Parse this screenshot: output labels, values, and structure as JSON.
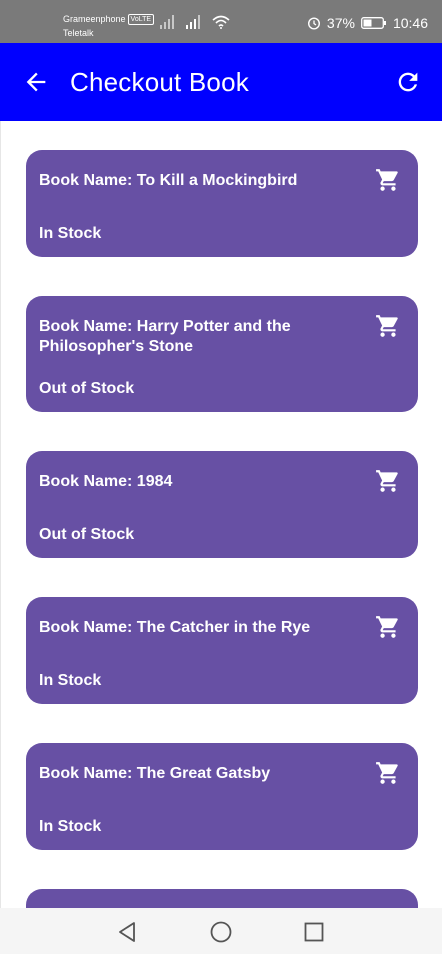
{
  "status_bar": {
    "carrier_1": "Grameenphone",
    "volte": "VoLTE",
    "carrier_2": "Teletalk",
    "battery": "37%",
    "time": "10:46",
    "icons": [
      "signal-icon",
      "signal-icon",
      "wifi-icon",
      "alarm-icon",
      "battery-icon"
    ]
  },
  "app_bar": {
    "title": "Checkout Book",
    "back_icon": "arrow-back-icon",
    "refresh_icon": "refresh-icon",
    "color": "#0000ff"
  },
  "books": [
    {
      "title": "Book Name: To Kill a Mockingbird",
      "status": "In Stock"
    },
    {
      "title": "Book Name: Harry Potter and the Philosopher's Stone",
      "status": "Out of Stock"
    },
    {
      "title": "Book Name: 1984",
      "status": "Out of Stock"
    },
    {
      "title": "Book Name: The Catcher in the Rye",
      "status": "In Stock"
    },
    {
      "title": "Book Name: The Great Gatsby",
      "status": "In Stock"
    }
  ],
  "card_color": "#6750a4",
  "card_icon": "shopping-cart-icon",
  "nav_bar": {
    "icons": [
      "back-triangle-icon",
      "home-circle-icon",
      "recents-square-icon"
    ]
  }
}
